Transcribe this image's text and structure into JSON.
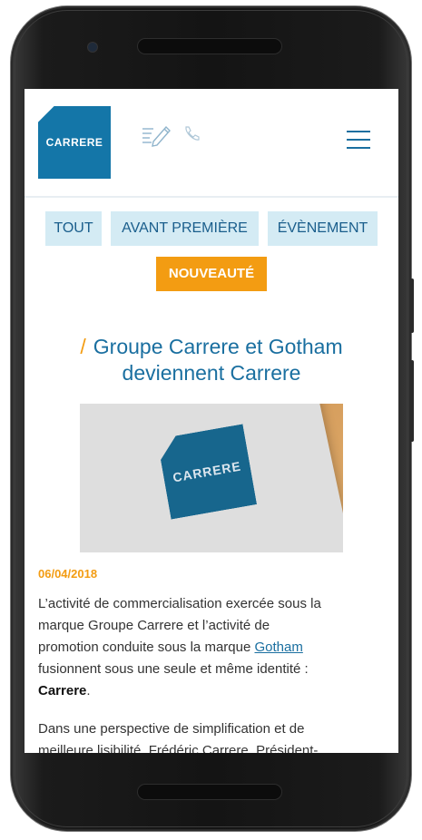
{
  "header": {
    "logo_text": "CARRERE",
    "icons": [
      "edit-icon",
      "phone-icon",
      "menu-icon"
    ],
    "brand_color": "#1476a8",
    "accent_color": "#f39c12"
  },
  "filters": {
    "items": [
      "TOUT",
      "AVANT PREMIÈRE",
      "ÉVÈNEMENT",
      "NOUVEAUTÉ"
    ],
    "active": "NOUVEAUTÉ"
  },
  "article": {
    "title_line1": "Groupe Carrere et Gotham",
    "title_line2": "deviennent Carrere",
    "image_logo_text": "CARRERE",
    "date": "06/04/2018",
    "p1_line1": "L’activité de commercialisation exercée sous la",
    "p1_line2": "marque Groupe Carrere et l’activité de",
    "p1_line3_before": "promotion conduite sous la marque ",
    "p1_link": "Gotham",
    "p1_line4": "fusionnent sous une seule et même identité :",
    "p1_bold": "Carrere",
    "p1_end": ".",
    "p2_line1": "Dans une perspective de simplification et de",
    "p2_line2": "meilleure lisibilité, Frédéric Carrere, Président-"
  }
}
